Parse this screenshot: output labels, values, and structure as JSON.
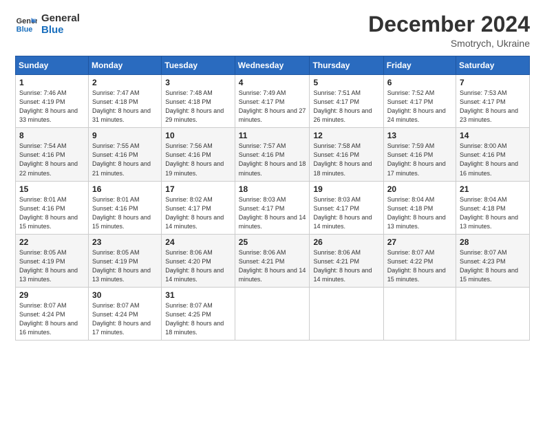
{
  "logo": {
    "line1": "General",
    "line2": "Blue"
  },
  "title": "December 2024",
  "subtitle": "Smotrych, Ukraine",
  "days_of_week": [
    "Sunday",
    "Monday",
    "Tuesday",
    "Wednesday",
    "Thursday",
    "Friday",
    "Saturday"
  ],
  "weeks": [
    [
      {
        "day": 1,
        "sunrise": "7:46 AM",
        "sunset": "4:19 PM",
        "daylight": "8 hours and 33 minutes."
      },
      {
        "day": 2,
        "sunrise": "7:47 AM",
        "sunset": "4:18 PM",
        "daylight": "8 hours and 31 minutes."
      },
      {
        "day": 3,
        "sunrise": "7:48 AM",
        "sunset": "4:18 PM",
        "daylight": "8 hours and 29 minutes."
      },
      {
        "day": 4,
        "sunrise": "7:49 AM",
        "sunset": "4:17 PM",
        "daylight": "8 hours and 27 minutes."
      },
      {
        "day": 5,
        "sunrise": "7:51 AM",
        "sunset": "4:17 PM",
        "daylight": "8 hours and 26 minutes."
      },
      {
        "day": 6,
        "sunrise": "7:52 AM",
        "sunset": "4:17 PM",
        "daylight": "8 hours and 24 minutes."
      },
      {
        "day": 7,
        "sunrise": "7:53 AM",
        "sunset": "4:17 PM",
        "daylight": "8 hours and 23 minutes."
      }
    ],
    [
      {
        "day": 8,
        "sunrise": "7:54 AM",
        "sunset": "4:16 PM",
        "daylight": "8 hours and 22 minutes."
      },
      {
        "day": 9,
        "sunrise": "7:55 AM",
        "sunset": "4:16 PM",
        "daylight": "8 hours and 21 minutes."
      },
      {
        "day": 10,
        "sunrise": "7:56 AM",
        "sunset": "4:16 PM",
        "daylight": "8 hours and 19 minutes."
      },
      {
        "day": 11,
        "sunrise": "7:57 AM",
        "sunset": "4:16 PM",
        "daylight": "8 hours and 18 minutes."
      },
      {
        "day": 12,
        "sunrise": "7:58 AM",
        "sunset": "4:16 PM",
        "daylight": "8 hours and 18 minutes."
      },
      {
        "day": 13,
        "sunrise": "7:59 AM",
        "sunset": "4:16 PM",
        "daylight": "8 hours and 17 minutes."
      },
      {
        "day": 14,
        "sunrise": "8:00 AM",
        "sunset": "4:16 PM",
        "daylight": "8 hours and 16 minutes."
      }
    ],
    [
      {
        "day": 15,
        "sunrise": "8:01 AM",
        "sunset": "4:16 PM",
        "daylight": "8 hours and 15 minutes."
      },
      {
        "day": 16,
        "sunrise": "8:01 AM",
        "sunset": "4:16 PM",
        "daylight": "8 hours and 15 minutes."
      },
      {
        "day": 17,
        "sunrise": "8:02 AM",
        "sunset": "4:17 PM",
        "daylight": "8 hours and 14 minutes."
      },
      {
        "day": 18,
        "sunrise": "8:03 AM",
        "sunset": "4:17 PM",
        "daylight": "8 hours and 14 minutes."
      },
      {
        "day": 19,
        "sunrise": "8:03 AM",
        "sunset": "4:17 PM",
        "daylight": "8 hours and 14 minutes."
      },
      {
        "day": 20,
        "sunrise": "8:04 AM",
        "sunset": "4:18 PM",
        "daylight": "8 hours and 13 minutes."
      },
      {
        "day": 21,
        "sunrise": "8:04 AM",
        "sunset": "4:18 PM",
        "daylight": "8 hours and 13 minutes."
      }
    ],
    [
      {
        "day": 22,
        "sunrise": "8:05 AM",
        "sunset": "4:19 PM",
        "daylight": "8 hours and 13 minutes."
      },
      {
        "day": 23,
        "sunrise": "8:05 AM",
        "sunset": "4:19 PM",
        "daylight": "8 hours and 13 minutes."
      },
      {
        "day": 24,
        "sunrise": "8:06 AM",
        "sunset": "4:20 PM",
        "daylight": "8 hours and 14 minutes."
      },
      {
        "day": 25,
        "sunrise": "8:06 AM",
        "sunset": "4:21 PM",
        "daylight": "8 hours and 14 minutes."
      },
      {
        "day": 26,
        "sunrise": "8:06 AM",
        "sunset": "4:21 PM",
        "daylight": "8 hours and 14 minutes."
      },
      {
        "day": 27,
        "sunrise": "8:07 AM",
        "sunset": "4:22 PM",
        "daylight": "8 hours and 15 minutes."
      },
      {
        "day": 28,
        "sunrise": "8:07 AM",
        "sunset": "4:23 PM",
        "daylight": "8 hours and 15 minutes."
      }
    ],
    [
      {
        "day": 29,
        "sunrise": "8:07 AM",
        "sunset": "4:24 PM",
        "daylight": "8 hours and 16 minutes."
      },
      {
        "day": 30,
        "sunrise": "8:07 AM",
        "sunset": "4:24 PM",
        "daylight": "8 hours and 17 minutes."
      },
      {
        "day": 31,
        "sunrise": "8:07 AM",
        "sunset": "4:25 PM",
        "daylight": "8 hours and 18 minutes."
      },
      null,
      null,
      null,
      null
    ]
  ]
}
